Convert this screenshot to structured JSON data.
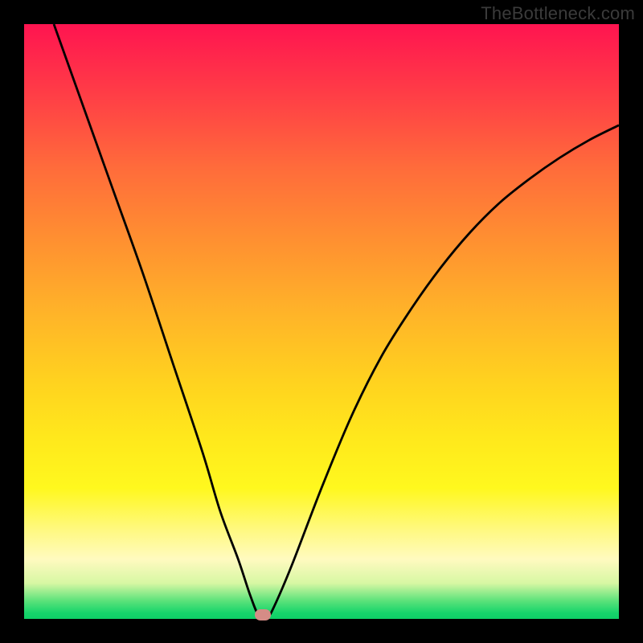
{
  "watermark": "TheBottleneck.com",
  "chart_data": {
    "type": "line",
    "title": "",
    "xlabel": "",
    "ylabel": "",
    "xlim": [
      0,
      100
    ],
    "ylim": [
      0,
      100
    ],
    "series": [
      {
        "name": "bottleneck_curve",
        "x": [
          5,
          10,
          15,
          20,
          25,
          30,
          33,
          36,
          38,
          39.5,
          41,
          42,
          45,
          50,
          55,
          60,
          65,
          70,
          75,
          80,
          85,
          90,
          95,
          100
        ],
        "values": [
          100,
          86,
          72,
          58,
          43,
          28,
          18,
          10,
          4,
          0.5,
          0.5,
          2,
          9,
          22,
          34,
          44,
          52,
          59,
          65,
          70,
          74,
          77.5,
          80.5,
          83
        ]
      }
    ],
    "marker": {
      "x": 40.2,
      "y": 0.7,
      "color": "#d58c86"
    },
    "background_gradient": {
      "top": "#ff1450",
      "mid": "#ffd21f",
      "bottom": "#0ecf66"
    }
  }
}
